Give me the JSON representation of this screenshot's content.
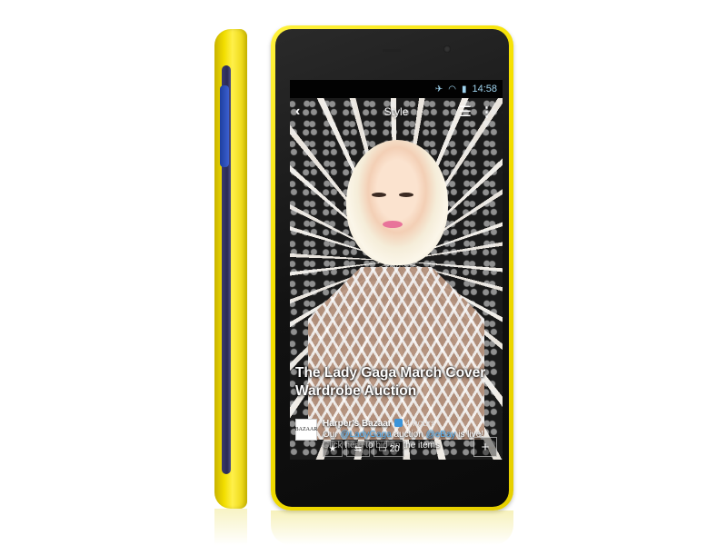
{
  "status_bar": {
    "time": "14:58"
  },
  "app_bar": {
    "title": "Style"
  },
  "article": {
    "headline": "The Lady Gaga March Cover Wardrobe Auction"
  },
  "tweet": {
    "avatar_label": "BAZAAR",
    "author": "Harper's Bazaar",
    "time": "4 hours",
    "body_prefix": "Our ",
    "mention_1": "@LadyGaga",
    "body_middle": " auction ",
    "mention_2": "@eBay",
    "body_suffix": " is live! Click here to bid on the items",
    "comment_count": "20"
  },
  "colors": {
    "phone_body": "#f5e000",
    "mention": "#59b0ef",
    "twitter_blue": "#3b94d9"
  },
  "icons": [
    "back-icon",
    "table-of-contents-icon",
    "overflow-menu-icon",
    "star-icon",
    "retweet-icon",
    "comment-icon",
    "plus-icon",
    "wifi-icon",
    "battery-icon"
  ]
}
